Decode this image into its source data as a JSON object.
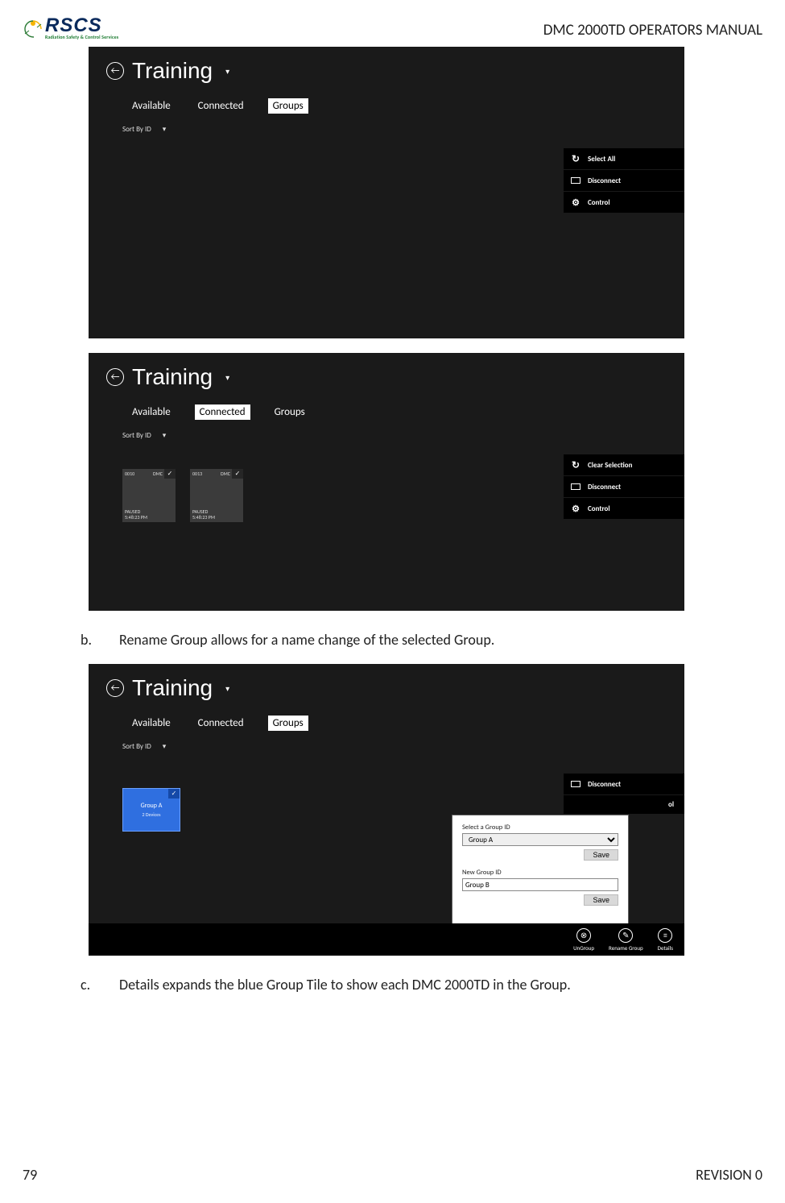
{
  "header": {
    "logo_main": "RSCS",
    "logo_sub": "Radiation Safety & Control Services",
    "doc_title": "DMC 2000TD OPERATORS MANUAL"
  },
  "app": {
    "title": "Training",
    "tabs": {
      "available": "Available",
      "connected": "Connected",
      "groups": "Groups"
    },
    "sort_label": "Sort By ID"
  },
  "shot1": {
    "active_tab": "groups",
    "actions": [
      {
        "icon": "refresh",
        "label": "Select All"
      },
      {
        "icon": "box",
        "label": "Disconnect"
      },
      {
        "icon": "gear",
        "label": "Control"
      }
    ]
  },
  "shot2": {
    "active_tab": "connected",
    "actions": [
      {
        "icon": "refresh",
        "label": "Clear Selection"
      },
      {
        "icon": "box",
        "label": "Disconnect"
      },
      {
        "icon": "gear",
        "label": "Control"
      }
    ],
    "tiles": [
      {
        "id": "0010",
        "type": "DMC",
        "state": "PAUSED",
        "time": "5:48:23 PM"
      },
      {
        "id": "0013",
        "type": "DMC",
        "state": "PAUSED",
        "time": "5:48:23 PM"
      }
    ]
  },
  "body_b": {
    "marker": "b.",
    "text": "Rename Group allows for a name change of the selected Group."
  },
  "shot3": {
    "active_tab": "groups",
    "side": [
      {
        "icon": "box",
        "label": "Disconnect"
      },
      {
        "icon": "gear",
        "label_fragment": "ol"
      }
    ],
    "group_tile": {
      "name": "Group A",
      "sub": "2 Devices"
    },
    "modal": {
      "select_label": "Select a Group ID",
      "select_value": "Group A",
      "new_label": "New Group ID",
      "new_value": "Group B",
      "save": "Save"
    },
    "cmds": [
      {
        "glyph": "⊗",
        "label": "UnGroup"
      },
      {
        "glyph": "✎",
        "label": "Rename Group"
      },
      {
        "glyph": "≡",
        "label": "Details"
      }
    ]
  },
  "body_c": {
    "marker": "c.",
    "text": "Details expands the blue Group Tile to show each DMC 2000TD in the Group."
  },
  "footer": {
    "page": "79",
    "rev": "REVISION 0"
  }
}
